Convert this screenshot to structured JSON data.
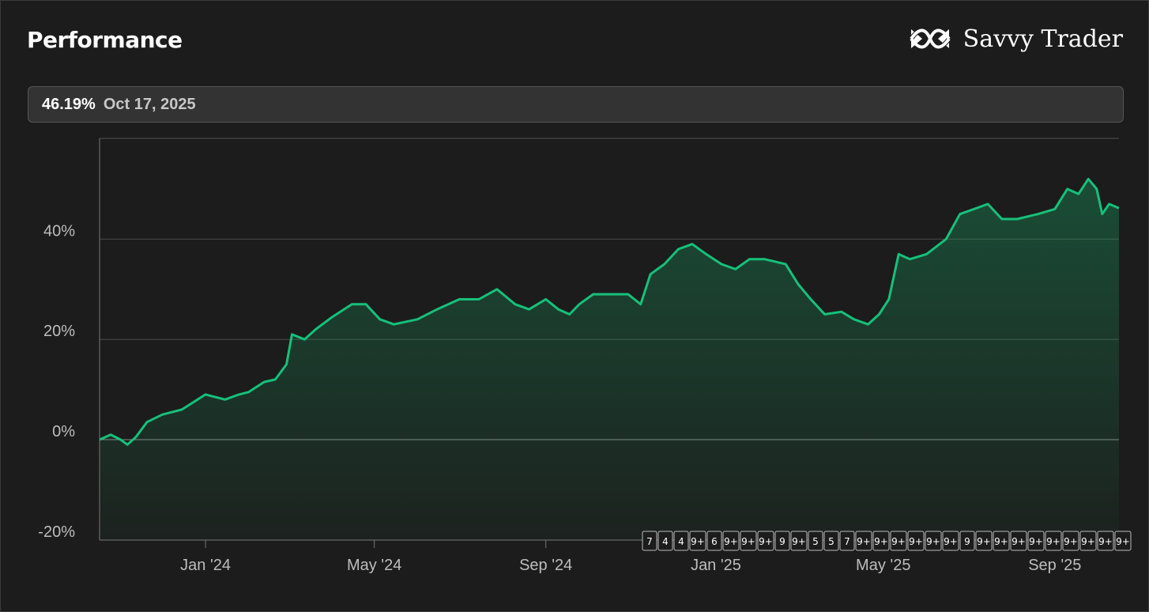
{
  "header": {
    "title": "Performance",
    "brand": "Savvy Trader"
  },
  "icons": {
    "brand_logo": "infinity-logo-icon"
  },
  "tooltip": {
    "value": "46.19%",
    "date": "Oct 17, 2025"
  },
  "colors": {
    "line": "#17c07a",
    "grid": "#4a4a4a",
    "background": "#1c1c1c"
  },
  "chart_data": {
    "type": "area",
    "x_tick_labels": [
      "Jan '24",
      "May '24",
      "Sep '24",
      "Jan '25",
      "May '25",
      "Sep '25"
    ],
    "y_tick_labels": [
      "40%",
      "20%",
      "0%",
      "-20%"
    ],
    "y_ticks": [
      40,
      20,
      0,
      -20
    ],
    "ylim": [
      -20,
      60
    ],
    "x_range": [
      "2023-10-17",
      "2025-10-17"
    ],
    "series": [
      {
        "points": [
          [
            "2023-10-17",
            0.0
          ],
          [
            "2023-10-25",
            1.0
          ],
          [
            "2023-11-01",
            0.0
          ],
          [
            "2023-11-06",
            -1.0
          ],
          [
            "2023-11-12",
            0.5
          ],
          [
            "2023-11-20",
            3.5
          ],
          [
            "2023-12-01",
            5.0
          ],
          [
            "2023-12-15",
            6.0
          ],
          [
            "2024-01-01",
            9.0
          ],
          [
            "2024-01-15",
            8.0
          ],
          [
            "2024-01-25",
            9.0
          ],
          [
            "2024-02-01",
            9.5
          ],
          [
            "2024-02-12",
            11.5
          ],
          [
            "2024-02-20",
            12.0
          ],
          [
            "2024-02-28",
            15.0
          ],
          [
            "2024-03-03",
            21.0
          ],
          [
            "2024-03-12",
            20.0
          ],
          [
            "2024-03-20",
            22.0
          ],
          [
            "2024-04-01",
            24.5
          ],
          [
            "2024-04-15",
            27.0
          ],
          [
            "2024-04-25",
            27.0
          ],
          [
            "2024-05-05",
            24.0
          ],
          [
            "2024-05-15",
            23.0
          ],
          [
            "2024-06-01",
            24.0
          ],
          [
            "2024-06-15",
            26.0
          ],
          [
            "2024-07-01",
            28.0
          ],
          [
            "2024-07-15",
            28.0
          ],
          [
            "2024-07-28",
            30.0
          ],
          [
            "2024-08-10",
            27.0
          ],
          [
            "2024-08-20",
            26.0
          ],
          [
            "2024-09-01",
            28.0
          ],
          [
            "2024-09-10",
            26.0
          ],
          [
            "2024-09-18",
            25.0
          ],
          [
            "2024-09-25",
            27.0
          ],
          [
            "2024-10-05",
            29.0
          ],
          [
            "2024-10-15",
            29.0
          ],
          [
            "2024-10-30",
            29.0
          ],
          [
            "2024-11-08",
            27.0
          ],
          [
            "2024-11-15",
            33.0
          ],
          [
            "2024-11-25",
            35.0
          ],
          [
            "2024-12-05",
            38.0
          ],
          [
            "2024-12-15",
            39.0
          ],
          [
            "2024-12-25",
            37.0
          ],
          [
            "2025-01-05",
            35.0
          ],
          [
            "2025-01-15",
            34.0
          ],
          [
            "2025-01-25",
            36.0
          ],
          [
            "2025-02-05",
            36.0
          ],
          [
            "2025-02-20",
            35.0
          ],
          [
            "2025-03-01",
            31.0
          ],
          [
            "2025-03-10",
            28.0
          ],
          [
            "2025-03-20",
            25.0
          ],
          [
            "2025-04-01",
            25.5
          ],
          [
            "2025-04-10",
            24.0
          ],
          [
            "2025-04-20",
            23.0
          ],
          [
            "2025-04-28",
            25.0
          ],
          [
            "2025-05-05",
            28.0
          ],
          [
            "2025-05-12",
            37.0
          ],
          [
            "2025-05-20",
            36.0
          ],
          [
            "2025-06-01",
            37.0
          ],
          [
            "2025-06-15",
            40.0
          ],
          [
            "2025-06-25",
            45.0
          ],
          [
            "2025-07-05",
            46.0
          ],
          [
            "2025-07-15",
            47.0
          ],
          [
            "2025-07-25",
            44.0
          ],
          [
            "2025-08-05",
            44.0
          ],
          [
            "2025-08-20",
            45.0
          ],
          [
            "2025-09-01",
            46.0
          ],
          [
            "2025-09-10",
            50.0
          ],
          [
            "2025-09-18",
            49.0
          ],
          [
            "2025-09-25",
            52.0
          ],
          [
            "2025-10-01",
            50.0
          ],
          [
            "2025-10-05",
            45.0
          ],
          [
            "2025-10-10",
            47.0
          ],
          [
            "2025-10-17",
            46.19
          ]
        ]
      }
    ],
    "event_markers": [
      "7",
      "4",
      "4",
      "9+",
      "6",
      "9+",
      "9+",
      "9+",
      "9",
      "9+",
      "5",
      "5",
      "7",
      "9+",
      "9+",
      "9+",
      "9+",
      "9+",
      "9+",
      "9",
      "9+",
      "9+",
      "9+",
      "9+",
      "9+",
      "9+",
      "9+",
      "9+",
      "9+"
    ]
  }
}
